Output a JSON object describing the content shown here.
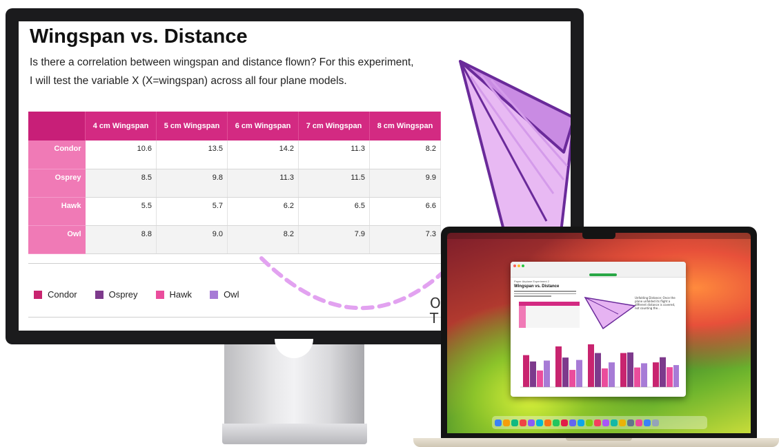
{
  "document": {
    "title": "Wingspan vs. Distance",
    "intro": "Is there a correlation between wingspan and distance flown? For this experiment, I will test the variable X (X=wingspan) across all four plane models.",
    "table": {
      "columns": [
        "4 cm Wingspan",
        "5 cm Wingspan",
        "6 cm Wingspan",
        "7 cm Wingspan",
        "8 cm Wingspan"
      ],
      "rows": [
        {
          "label": "Condor",
          "values": [
            "10.6",
            "13.5",
            "14.2",
            "11.3",
            "8.2"
          ]
        },
        {
          "label": "Osprey",
          "values": [
            "8.5",
            "9.8",
            "11.3",
            "11.5",
            "9.9"
          ]
        },
        {
          "label": "Hawk",
          "values": [
            "5.5",
            "5.7",
            "6.2",
            "6.5",
            "6.6"
          ]
        },
        {
          "label": "Owl",
          "values": [
            "8.8",
            "9.0",
            "8.2",
            "7.9",
            "7.3"
          ]
        }
      ]
    },
    "legend": [
      {
        "label": "Condor",
        "color": "#c8246f"
      },
      {
        "label": "Osprey",
        "color": "#7d3a8c"
      },
      {
        "label": "Hawk",
        "color": "#ea4d9c"
      },
      {
        "label": "Owl",
        "color": "#a77bd6"
      }
    ],
    "handwriting": "O\nT"
  },
  "laptop": {
    "window_title": "Paper Airplane Experiment",
    "doc_subtitle": "Paper Airplane Experiment 2",
    "doc_heading": "Wingspan vs. Distance",
    "note": "Unfolding Distance: Once the plane unfolded its flight a different distance is covered, not counting the...",
    "dock_colors": [
      "#3b82f6",
      "#f59e0b",
      "#10b981",
      "#ef4444",
      "#8b5cf6",
      "#06b6d4",
      "#f97316",
      "#22c55e",
      "#e11d48",
      "#6366f1",
      "#0ea5e9",
      "#84cc16",
      "#f43f5e",
      "#a855f7",
      "#14b8a6",
      "#eab308",
      "#64748b",
      "#ec4899",
      "#3b82f6",
      "#94a3b8"
    ]
  },
  "colors": {
    "table_header": "#d32a82",
    "row_header": "#f07ab6",
    "plane_fill": "#e6b3f2",
    "plane_stroke": "#6a2a9a"
  }
}
